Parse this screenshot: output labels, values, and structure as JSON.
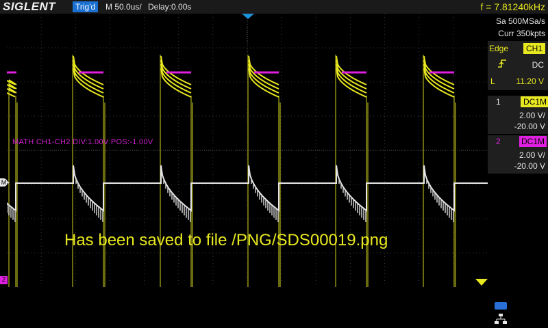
{
  "header": {
    "brand": "SIGLENT",
    "trigger_state": "Trig'd",
    "timebase": "M 50.0us/",
    "delay": "Delay:0.00s",
    "frequency": "f = 7.81240kHz"
  },
  "acquisition": {
    "sample_rate": "Sa 500MSa/s",
    "memory": "Curr 350kpts"
  },
  "trigger": {
    "type": "Edge",
    "source": "CH1",
    "slope_icon": "rising-edge-icon",
    "coupling": "DC",
    "level_label": "L",
    "level": "11.20 V"
  },
  "channels": [
    {
      "number": "1",
      "coupling": "DC1M",
      "scale": "2.00 V/",
      "offset": "-20.00 V",
      "color": "#e8e820"
    },
    {
      "number": "2",
      "coupling": "DC1M",
      "scale": "2.00 V/",
      "offset": "-20.00 V",
      "color": "#e020e0"
    }
  ],
  "math": {
    "label": "MATH  CH1-CH2  DIV:1.00V  POS:-1.00V",
    "marker": "M"
  },
  "status_message": "Has been saved to file /PNG/SDS00019.png",
  "markers": {
    "ch2_ground": "2"
  },
  "colors": {
    "ch1": "#e8e820",
    "ch2": "#e020e0",
    "math": "#e6e6e6",
    "accent": "#1a6fd1"
  },
  "icons": {
    "usb": "usb-icon",
    "network": "network-icon"
  }
}
